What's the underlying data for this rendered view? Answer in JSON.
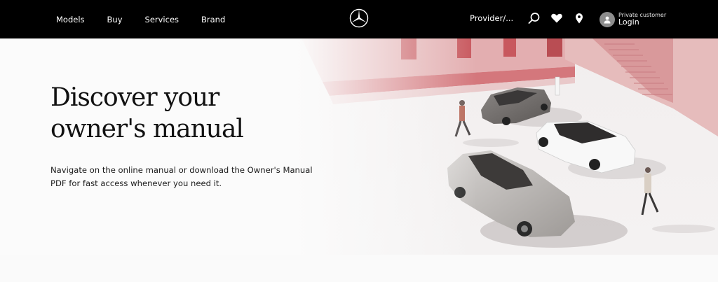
{
  "header": {
    "nav": [
      "Models",
      "Buy",
      "Services",
      "Brand"
    ],
    "provider_label": "Provider/...",
    "icons": [
      "search-icon",
      "heart-icon",
      "location-pin-icon"
    ],
    "account": {
      "subtitle": "Private customer",
      "label": "Login",
      "icon": "user-icon"
    },
    "logo": "mercedes-star-logo"
  },
  "hero": {
    "title": "Discover your owner's manual",
    "description": "Navigate on the online manual or download the Owner's Manual PDF for fast access whenever you need it."
  },
  "colors": {
    "header_bg": "#000000",
    "accent_red": "#c95a5e",
    "page_bg": "#fafafa"
  }
}
